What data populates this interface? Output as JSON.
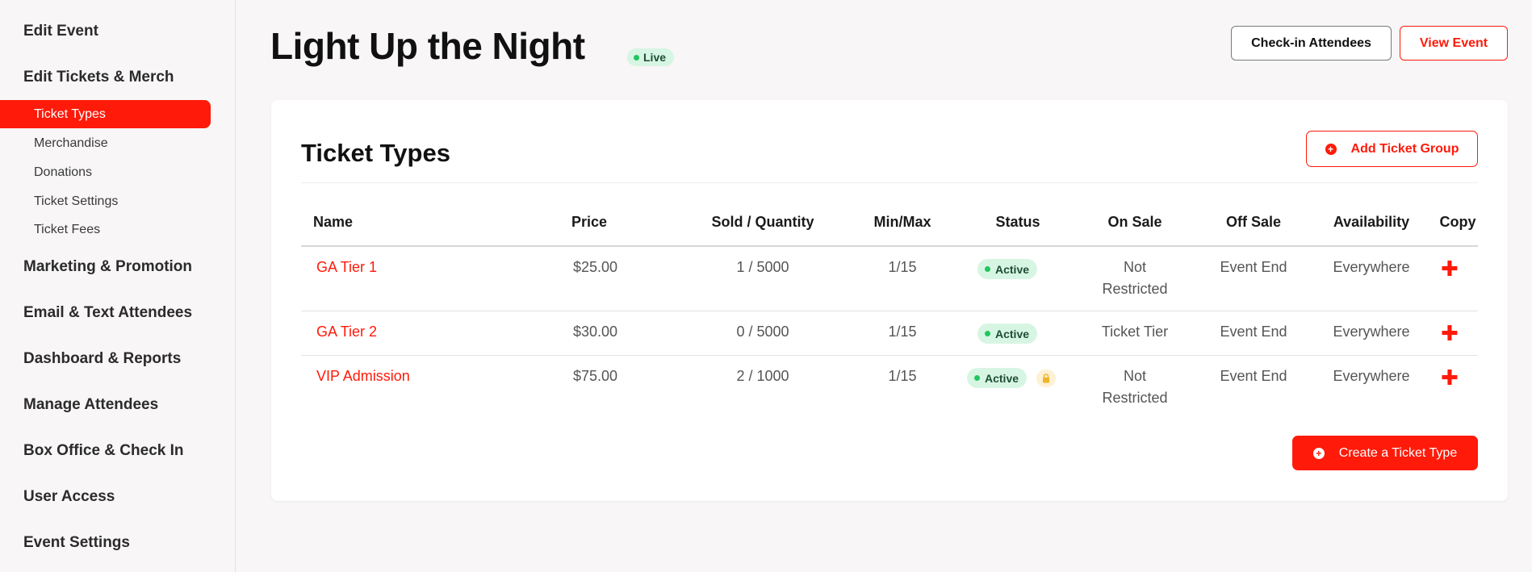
{
  "sidebar": {
    "sections": [
      {
        "label": "Edit Event"
      },
      {
        "label": "Edit Tickets & Merch"
      },
      {
        "label": "Marketing & Promotion"
      },
      {
        "label": "Email & Text Attendees"
      },
      {
        "label": "Dashboard & Reports"
      },
      {
        "label": "Manage Attendees"
      },
      {
        "label": "Box Office & Check In"
      },
      {
        "label": "User Access"
      },
      {
        "label": "Event Settings"
      }
    ],
    "subitems": [
      {
        "label": "Ticket Types",
        "active": true
      },
      {
        "label": "Merchandise"
      },
      {
        "label": "Donations"
      },
      {
        "label": "Ticket Settings"
      },
      {
        "label": "Ticket Fees"
      }
    ]
  },
  "header": {
    "title": "Light Up the Night",
    "status": "Live",
    "checkin_label": "Check-in Attendees",
    "view_label": "View Event"
  },
  "card": {
    "title": "Ticket Types",
    "add_group_label": "Add Ticket Group",
    "create_label": "Create a Ticket Type"
  },
  "table": {
    "columns": [
      "Name",
      "Price",
      "Sold / Quantity",
      "Min/Max",
      "Status",
      "On Sale",
      "Off Sale",
      "Availability",
      "Copy"
    ],
    "rows": [
      {
        "name": "GA Tier 1",
        "price": "$25.00",
        "sold": "1 / 5000",
        "minmax": "1/15",
        "status": "Active",
        "on_sale_1": "Not",
        "on_sale_2": "Restricted",
        "off_sale": "Event End",
        "availability": "Everywhere",
        "locked": false
      },
      {
        "name": "GA Tier 2",
        "price": "$30.00",
        "sold": "0 / 5000",
        "minmax": "1/15",
        "status": "Active",
        "on_sale_1": "Ticket Tier",
        "on_sale_2": "",
        "off_sale": "Event End",
        "availability": "Everywhere",
        "locked": false
      },
      {
        "name": "VIP Admission",
        "price": "$75.00",
        "sold": "2 / 1000",
        "minmax": "1/15",
        "status": "Active",
        "on_sale_1": "Not",
        "on_sale_2": "Restricted",
        "off_sale": "Event End",
        "availability": "Everywhere",
        "locked": true
      }
    ]
  },
  "colors": {
    "accent": "#ff1a0a",
    "active_bg": "#d7f5e3",
    "active_dot": "#22c55e"
  },
  "icons": {
    "status_dot": "green-dot-icon",
    "lock": "lock-icon",
    "copy": "plus-icon",
    "add": "plus-circle-icon"
  }
}
